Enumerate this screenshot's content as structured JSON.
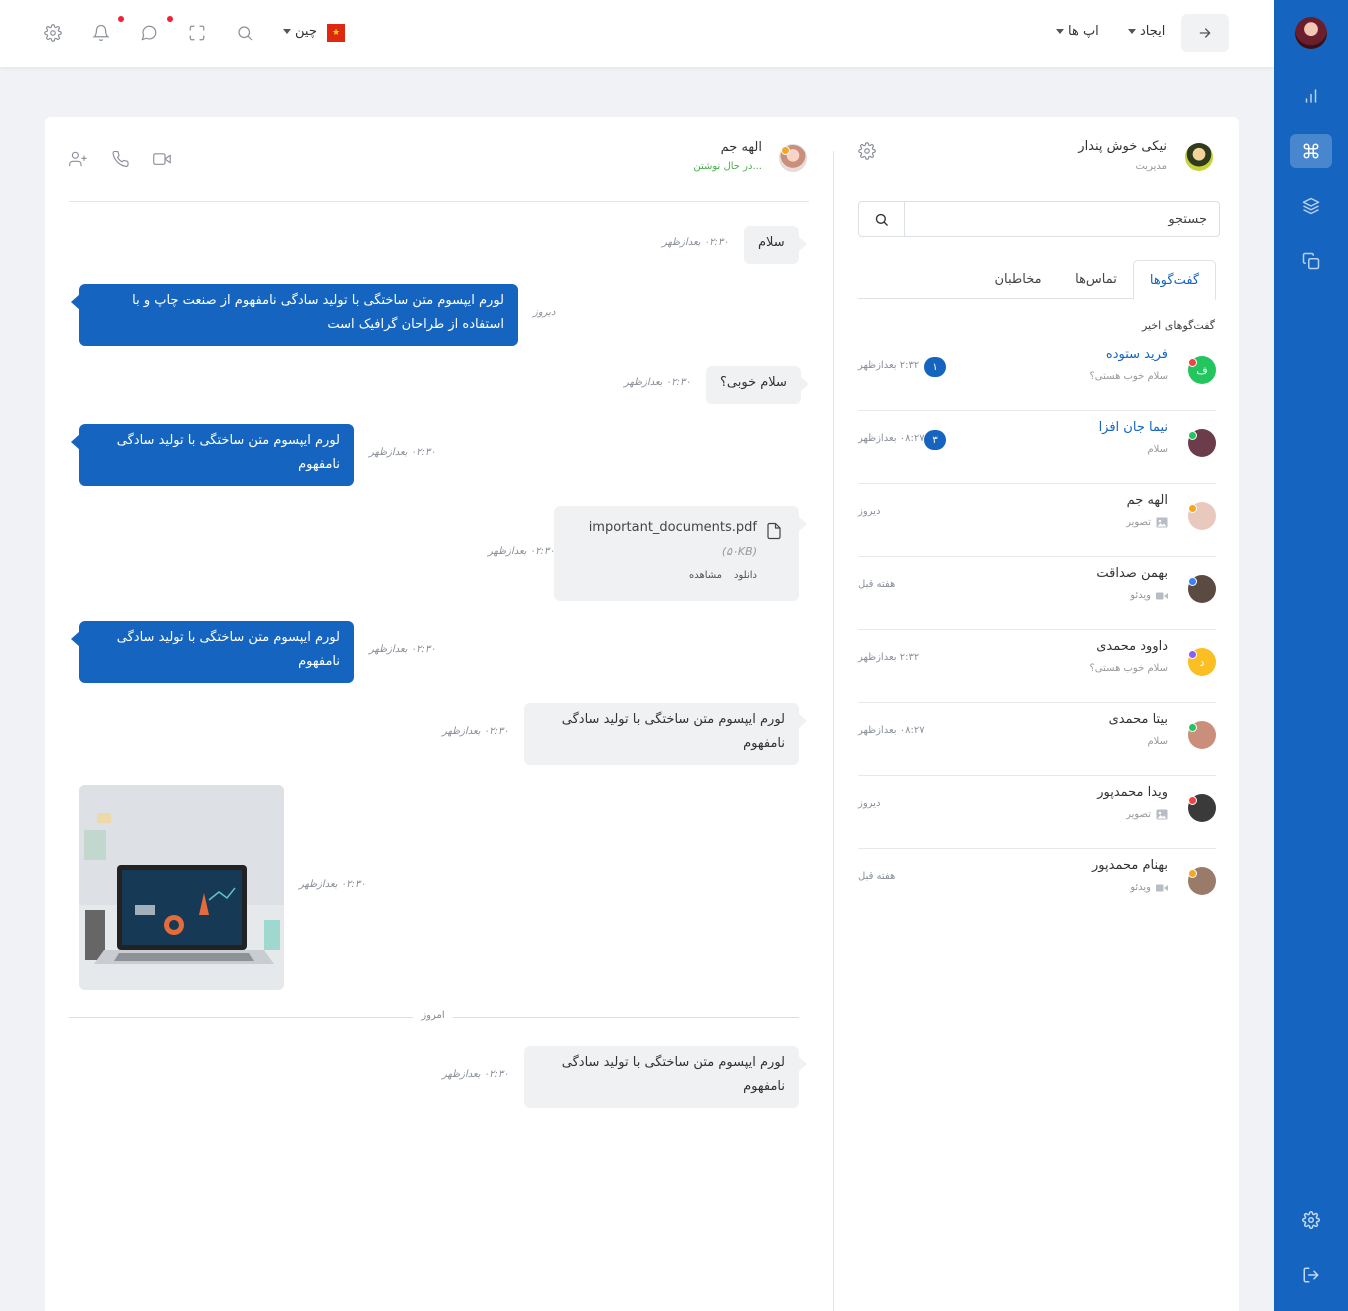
{
  "topbar": {
    "create_label": "ایجاد",
    "apps_label": "اپ ها",
    "language_label": "چین",
    "flag_symbol": "★"
  },
  "sidebar": {
    "items": [
      "chart-icon",
      "command-icon",
      "layers-icon",
      "copy-icon"
    ],
    "bottom": [
      "gear-icon",
      "logout-icon"
    ]
  },
  "user": {
    "name": "نیکی خوش پندار",
    "role": "مدیریت"
  },
  "search": {
    "placeholder": "جستجو"
  },
  "tabs": [
    {
      "label": "گفت‌گوها",
      "active": true
    },
    {
      "label": "تماس‌ها",
      "active": false
    },
    {
      "label": "مخاطبان",
      "active": false
    }
  ],
  "recent_title": "گفت‌گوهای اخیر",
  "conversations": [
    {
      "name": "فرید ستوده",
      "preview": "سلام خوب هستی؟",
      "time": "۲:۳۲ بعدازظهر",
      "badge": "۱",
      "avatar_letter": "ف",
      "avatar_color": "#22c55e",
      "status_color": "#ef4444",
      "name_color": "#1565c0",
      "preview_icon": ""
    },
    {
      "name": "نیما جان افزا",
      "preview": "سلام",
      "time": "۰۸:۲۷ بعدازظهر",
      "badge": "۳",
      "avatar_letter": "",
      "avatar_color": "#6b3c4a",
      "status_color": "#22c55e",
      "name_color": "#1565c0",
      "preview_icon": ""
    },
    {
      "name": "الهه جم",
      "preview": "تصویر",
      "time": "دیروز",
      "badge": "",
      "avatar_letter": "",
      "avatar_color": "#e9c9bd",
      "status_color": "#f5a623",
      "name_color": "#333333",
      "preview_icon": "image-icon"
    },
    {
      "name": "بهمن صداقت",
      "preview": "ویدئو",
      "time": "هفته قبل",
      "badge": "",
      "avatar_letter": "",
      "avatar_color": "#5b4a42",
      "status_color": "#3b82f6",
      "name_color": "#333333",
      "preview_icon": "video-icon"
    },
    {
      "name": "داوود محمدی",
      "preview": "سلام خوب هستی؟",
      "time": "۲:۳۲ بعدازظهر",
      "badge": "",
      "avatar_letter": "د",
      "avatar_color": "#fbbf24",
      "status_color": "#8b5cf6",
      "name_color": "#333333",
      "preview_icon": ""
    },
    {
      "name": "بیتا محمدی",
      "preview": "سلام",
      "time": "۰۸:۲۷ بعدازظهر",
      "badge": "",
      "avatar_letter": "",
      "avatar_color": "#c98f7a",
      "status_color": "#22c55e",
      "name_color": "#333333",
      "preview_icon": ""
    },
    {
      "name": "ویدا محمدپور",
      "preview": "تصویر",
      "time": "دیروز",
      "badge": "",
      "avatar_letter": "",
      "avatar_color": "#3a3a3a",
      "status_color": "#ef4444",
      "name_color": "#333333",
      "preview_icon": "image-icon"
    },
    {
      "name": "بهنام محمدپور",
      "preview": "ویدئو",
      "time": "هفته قبل",
      "badge": "",
      "avatar_letter": "",
      "avatar_color": "#9a7b6a",
      "status_color": "#f5a623",
      "name_color": "#333333",
      "preview_icon": "video-icon"
    }
  ],
  "chat": {
    "contact_name": "الهه جم",
    "typing_status": "در حال نوشتن...",
    "today_label": "امروز",
    "messages": [
      {
        "text": "سلام",
        "time": "۰۲:۳۰ بعدازظهر"
      },
      {
        "text": "لورم ایپسوم متن ساختگی با تولید سادگی نامفهوم از صنعت چاپ و با استفاده از طراحان گرافیک است",
        "time": "دیروز"
      },
      {
        "text": "سلام خوبی؟",
        "time": "۰۲:۳۰ بعدازظهر"
      },
      {
        "text": "لورم ایپسوم متن ساختگی با تولید سادگی نامفهوم",
        "time": "۰۲:۳۰ بعدازظهر"
      },
      {
        "file_name": "important_documents.pdf",
        "file_size": "(۵۰KB)",
        "download": "دانلود",
        "view": "مشاهده",
        "time": "۰۲:۳۰ بعدازظهر"
      },
      {
        "text": "لورم ایپسوم متن ساختگی با تولید سادگی نامفهوم",
        "time": "۰۲:۳۰ بعدازظهر"
      },
      {
        "text": "لورم ایپسوم متن ساختگی با تولید سادگی نامفهوم",
        "time": "۰۲:۳۰ بعدازظهر"
      },
      {
        "image": "laptop-photo",
        "time": "۰۲:۳۰ بعدازظهر"
      },
      {
        "text": "لورم ایپسوم متن ساختگی با تولید سادگی نامفهوم",
        "time": "۰۲:۳۰ بعدازظهر"
      }
    ]
  },
  "colors": {
    "primary": "#1565c0",
    "notification": "#f0213b",
    "typing": "#4caf50"
  }
}
